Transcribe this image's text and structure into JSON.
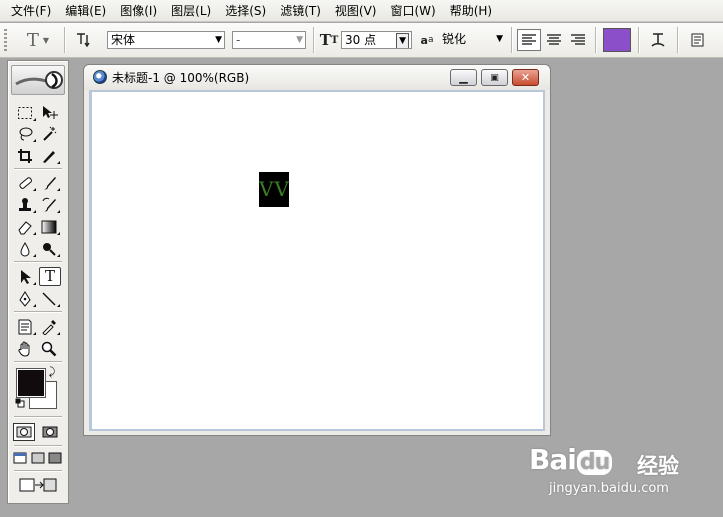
{
  "menu": {
    "items": [
      "文件(F)",
      "编辑(E)",
      "图像(I)",
      "图层(L)",
      "选择(S)",
      "滤镜(T)",
      "视图(V)",
      "窗口(W)",
      "帮助(H)"
    ]
  },
  "options": {
    "font_family": "宋体",
    "font_style": "-",
    "font_size": "30 点",
    "antialias_label": "a",
    "antialias_label_sub": "a",
    "antialias": "锐化",
    "text_color": "#8b4fc9"
  },
  "toolbox": {
    "foreground_color": "#120b0e",
    "background_color": "#ffffff"
  },
  "document": {
    "title": "未标题-1 @ 100%(RGB)",
    "text_content": "VV",
    "text_color": "#3d7d26"
  },
  "watermark": {
    "logo_text": "Bai",
    "logo_paw": "du",
    "name_cn": "经验",
    "url": "jingyan.baidu.com"
  }
}
